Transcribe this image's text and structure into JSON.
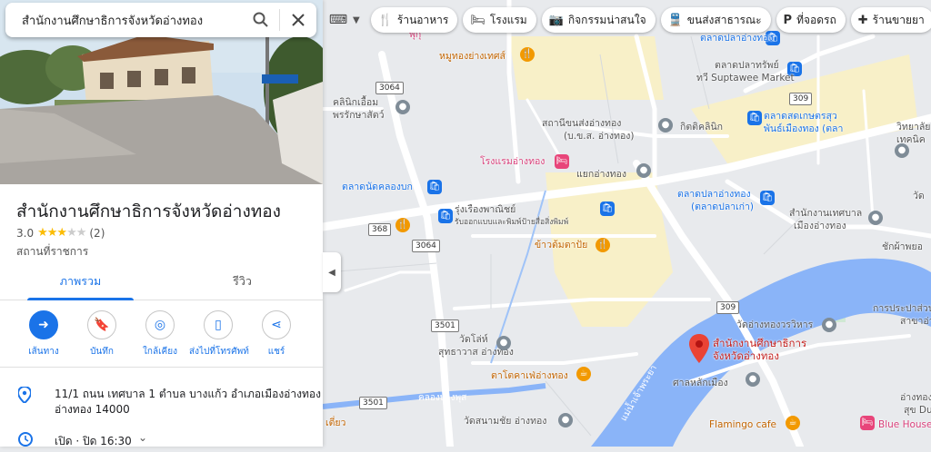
{
  "search": {
    "query": "สำนักงานศึกษาธิการจังหวัดอ่างทอง"
  },
  "place": {
    "title": "สำนักงานศึกษาธิการจังหวัดอ่างทอง",
    "rating": "3.0",
    "stars": 3,
    "review_count": "(2)",
    "category": "สถานที่ราชการ"
  },
  "tabs": [
    {
      "label": "ภาพรวม",
      "active": true
    },
    {
      "label": "รีวิว",
      "active": false
    }
  ],
  "actions": [
    {
      "label": "เส้นทาง",
      "icon": "directions-icon"
    },
    {
      "label": "บันทึก",
      "icon": "bookmark-icon"
    },
    {
      "label": "ใกล้เคียง",
      "icon": "nearby-icon"
    },
    {
      "label": "ส่งไปที่โทรศัพท์",
      "icon": "send-to-phone-icon"
    },
    {
      "label": "แชร์",
      "icon": "share-icon"
    }
  ],
  "details": {
    "address_line1": "11/1 ถนน เทศบาล 1 ตำบล บางแก้ว อำเภอเมืองอ่างทอง",
    "address_line2": "อ่างทอง 14000",
    "hours": "เปิด · ปิด 16:30"
  },
  "chips": [
    {
      "label": "ร้านอาหาร",
      "icon": "restaurant-icon"
    },
    {
      "label": "โรงแรม",
      "icon": "hotel-icon"
    },
    {
      "label": "กิจกรรมน่าสนใจ",
      "icon": "attraction-icon"
    },
    {
      "label": "ขนส่งสาธารณะ",
      "icon": "transit-icon"
    },
    {
      "label": "ที่จอดรถ",
      "icon": "parking-icon"
    },
    {
      "label": "ร้านขายยา",
      "icon": "pharmacy-icon"
    }
  ],
  "map_labels": {
    "market_top": "ตลาดปลาอ่างทอง",
    "moo_thong": "หมูทองย่างเทศส์",
    "suptawee_th": "ตลาดปลาทรัพย์",
    "suptawee_en": "ทวี Suptawee Market",
    "clinic": "คลินิกเอื้อม",
    "clinic2": "พรรักษาสัตว์",
    "bus_station": "สถานีขนส่งอ่างทอง",
    "bus_station2": "(บ.ข.ส. อ่างทอง)",
    "kitti": "กิตติคลินิก",
    "fresh_market": "ตลาดสดเกษตรสุว",
    "fresh_market2": "พันธ์เมืองทอง (ตลา",
    "hotel": "โรงแรมอ่างทอง",
    "intersection": "แยกอ่างทอง",
    "talad_nad": "ตลาดนัดคลองบก",
    "print_shop": "รุ่งเรืองพาณิชย์",
    "print_shop2": "รับออกแบบและพิมพ์ป้ายสื่อสิ่งพิมพ์",
    "fish_market": "ตลาดปลาอ่างทอง",
    "fish_market2": "(ตลาดปลาเก่า)",
    "municipal": "สำนักงานเทศบาล",
    "municipal2": "เมืองอ่างทอง",
    "rice": "ข้าวต้มตาปัย",
    "wat_hoi": "วัดโล่ห์",
    "wat_hoi2": "สุทธาวาส อ่างทอง",
    "coffee": "ตาโตคาเฟ่อ่างทอง",
    "wat_angthong": "วัดอ่างทองวรวิหาร",
    "destination": "สำนักงานศึกษาธิการ",
    "destination2": "จังหวัดอ่างทอง",
    "shrine": "ศาลหลักเมือง",
    "khlong": "คลองบางพุส",
    "wat_sanam": "วัดสนามชัย อ่างทอง",
    "flamingo": "Flamingo cafe",
    "blue_house": "Blue House",
    "river": "แม่น้ำเจ้าพระยา",
    "prapa": "การประปาส่วน",
    "prapa2": "สาขาอ่า",
    "college": "วิทยาลัย",
    "college2": "เทคนิค",
    "temple_r": "วัด",
    "chak": "ชักผ้าพยอ",
    "kluay": "เตี่ยว",
    "angthong_r": "อ่างทอง",
    "suk": "สุข Duk",
    "r3064a": "3064",
    "r3064b": "3064",
    "r309a": "309",
    "r309b": "309",
    "r368": "368",
    "r3501a": "3501",
    "r3501b": "3501",
    "prik": "พุกุ"
  }
}
